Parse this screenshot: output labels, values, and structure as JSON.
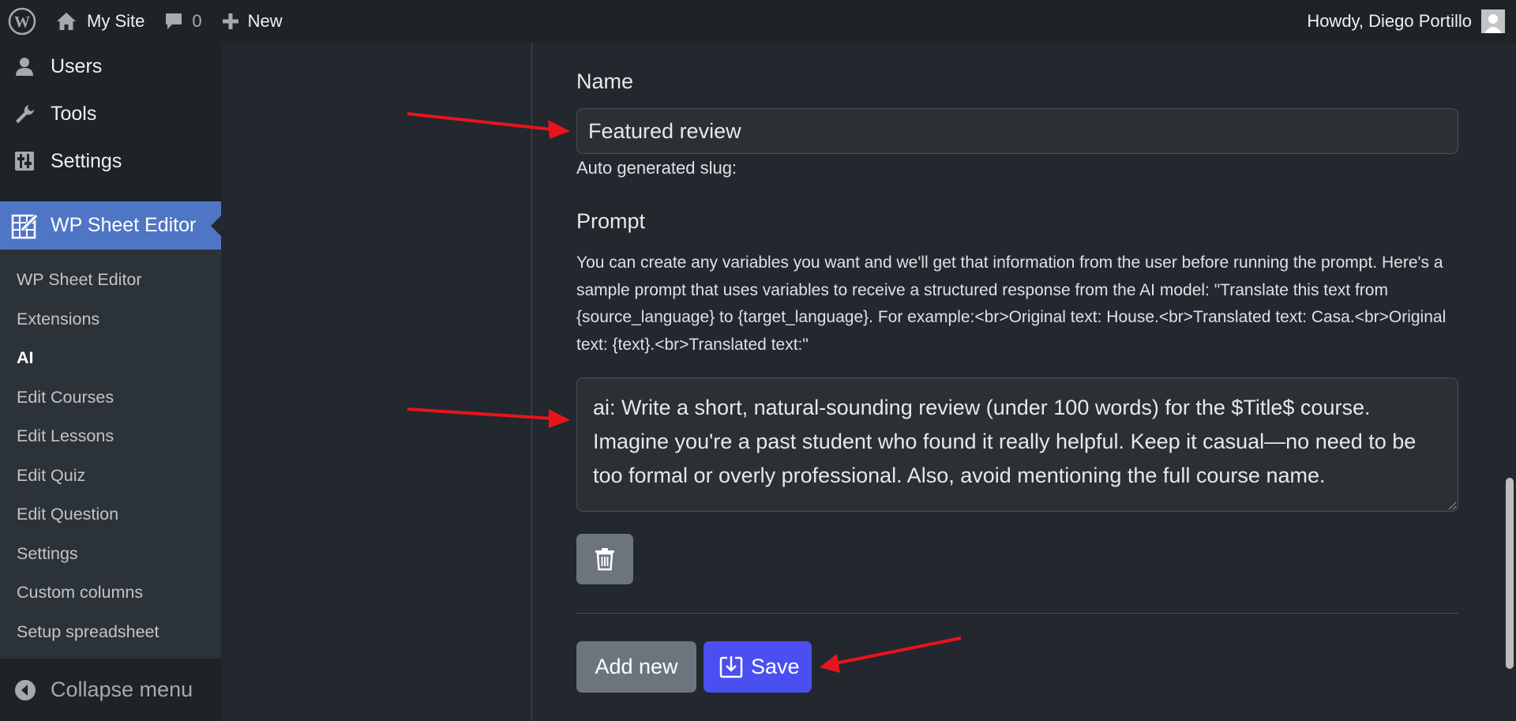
{
  "adminbar": {
    "site_name": "My Site",
    "comments_count": "0",
    "new_label": "New",
    "greeting": "Howdy, Diego Portillo"
  },
  "sidebar": {
    "top_items": [
      {
        "label": "Users",
        "icon": "user-icon"
      },
      {
        "label": "Tools",
        "icon": "wrench-icon"
      },
      {
        "label": "Settings",
        "icon": "sliders-icon"
      }
    ],
    "current": {
      "label": "WP Sheet Editor",
      "icon": "spreadsheet-pencil-icon"
    },
    "submenu": [
      {
        "label": "WP Sheet Editor"
      },
      {
        "label": "Extensions"
      },
      {
        "label": "AI",
        "active": true
      },
      {
        "label": "Edit Courses"
      },
      {
        "label": "Edit Lessons"
      },
      {
        "label": "Edit Quiz"
      },
      {
        "label": "Edit Question"
      },
      {
        "label": "Settings"
      },
      {
        "label": "Custom columns"
      },
      {
        "label": "Setup spreadsheet"
      }
    ],
    "collapse_label": "Collapse menu"
  },
  "form": {
    "name_label": "Name",
    "name_value": "Featured review",
    "slug_label": "Auto generated slug:",
    "prompt_label": "Prompt",
    "prompt_help": "You can create any variables you want and we'll get that information from the user before running the prompt. Here's a sample prompt that uses variables to receive a structured response from the AI model: \"Translate this text from {source_language} to {target_language}. For example:<br>Original text: House.<br>Translated text: Casa.<br>Original text: {text}.<br>Translated text:\"",
    "prompt_value": "ai: Write a short, natural-sounding review (under 100 words) for the $Title$ course. Imagine you're a past student who found it really helpful. Keep it casual—no need to be too formal or overly professional. Also, avoid mentioning the full course name.",
    "add_new_label": "Add new",
    "save_label": "Save"
  },
  "colors": {
    "save_button": "#4b4ff0",
    "menu_current": "#4f76c4",
    "annotation_arrow": "#e8141c"
  }
}
